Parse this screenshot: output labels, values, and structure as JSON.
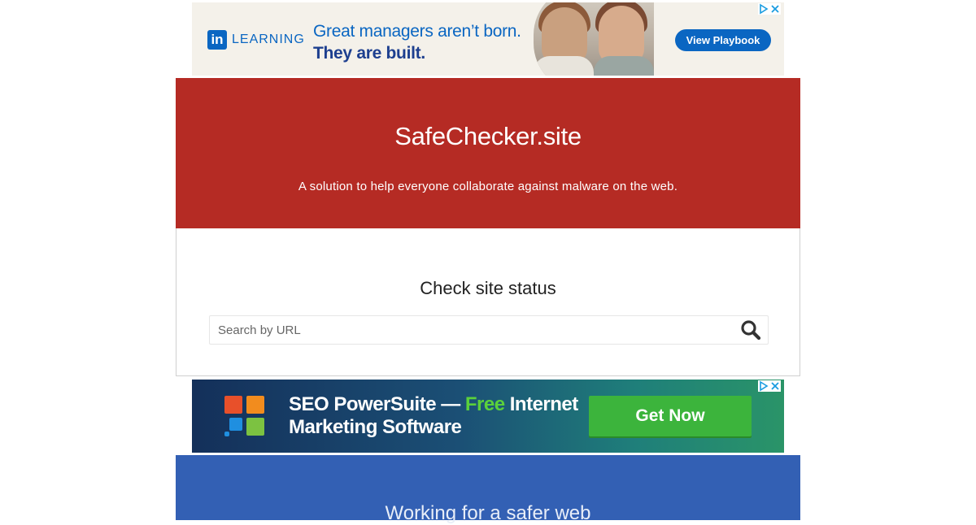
{
  "ad_top": {
    "brand_mark": "in",
    "brand_word": "LEARNING",
    "headline_line1": "Great managers aren’t born.",
    "headline_line2": "They are built.",
    "cta": "View Playbook",
    "adchoices_icon": "adchoices-icon",
    "close_icon": "close-icon"
  },
  "header": {
    "title": "SafeChecker.site",
    "tagline": "A solution to help everyone collaborate against malware on the web."
  },
  "check": {
    "heading": "Check site status",
    "search_placeholder": "Search by URL",
    "search_value": "",
    "search_icon": "search-icon"
  },
  "ad_mid": {
    "text_part1": "SEO PowerSuite —",
    "text_free": "Free",
    "text_part2": "Internet",
    "text_line2": "Marketing Software",
    "cta": "Get Now",
    "logo_colors": [
      "#e8502a",
      "#f28c1e",
      "#1f8fe0",
      "#7cc241"
    ]
  },
  "footer": {
    "heading": "Working for a safer web"
  },
  "colors": {
    "header_bg": "#b52b24",
    "footer_bg": "#3360b4",
    "linkedin_blue": "#0a66c2",
    "ad_cta_green": "#3cb43c"
  }
}
